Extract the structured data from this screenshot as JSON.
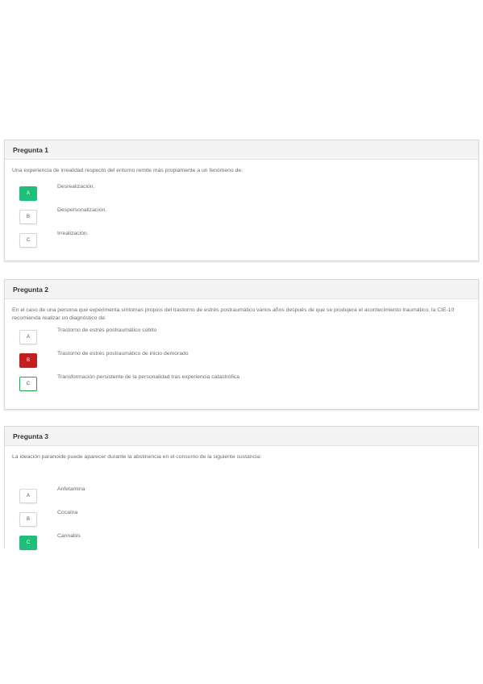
{
  "questions": [
    {
      "title": "Pregunta 1",
      "text": "Una experiencia de irrealidad respecto del entorno remite más propiamente a un fenómeno de:",
      "options": [
        {
          "letter": "A",
          "text": "Desrealización.",
          "state": "correct"
        },
        {
          "letter": "B",
          "text": "Despersonalización.",
          "state": "none"
        },
        {
          "letter": "C",
          "text": "Irrealización.",
          "state": "none"
        }
      ]
    },
    {
      "title": "Pregunta 2",
      "text": "En el caso de una persona que experimenta síntomas propios del trastorno de estrés postraumático varios años después de que se produjera el acontecimiento traumático, la CIE-10 recomienda realizar un diagnóstico de:",
      "options": [
        {
          "letter": "A",
          "text": "Trastorno de estrés postraumático súbito",
          "state": "none"
        },
        {
          "letter": "B",
          "text": "Trastorno de estrés postraumático de inicio demorado",
          "state": "wrong"
        },
        {
          "letter": "C",
          "text": "Transformación persistente de la personalidad tras experiencia catastrófica",
          "state": "outline"
        }
      ]
    },
    {
      "title": "Pregunta 3",
      "text": "La ideación paranoide puede aparecer durante la abstinencia en el consumo de la siguiente sustancia:",
      "options": [
        {
          "letter": "A",
          "text": "Anfetamina",
          "state": "none"
        },
        {
          "letter": "B",
          "text": "Cocaína",
          "state": "none"
        },
        {
          "letter": "C",
          "text": "Cannabis",
          "state": "correct"
        }
      ]
    }
  ],
  "colors": {
    "correct": "#1fbf7a",
    "wrong": "#c41f1f",
    "outline": "#2e9e4f"
  }
}
